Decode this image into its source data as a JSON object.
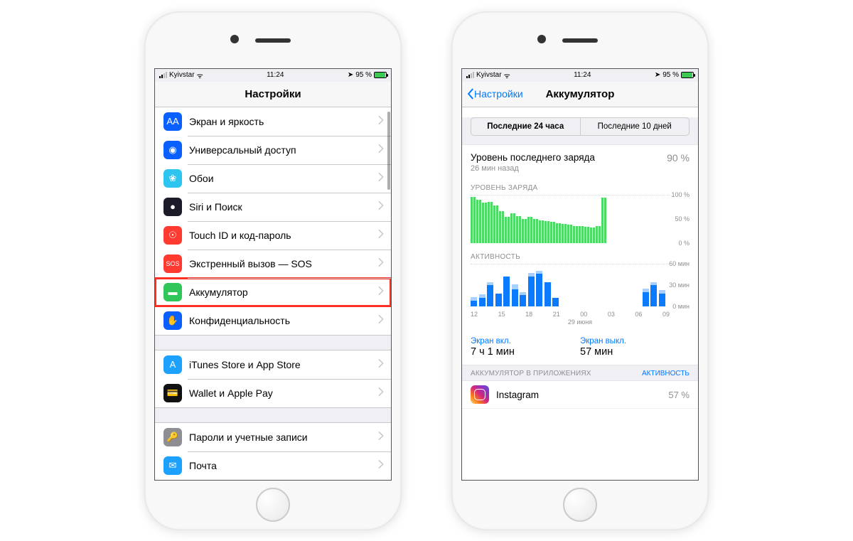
{
  "status": {
    "carrier": "Kyivstar",
    "time": "11:24",
    "battery_pct": "95 %"
  },
  "left": {
    "title": "Настройки",
    "items": [
      {
        "label": "Экран и яркость",
        "icon_bg": "#0a60ff",
        "icon_text": "AA"
      },
      {
        "label": "Универсальный доступ",
        "icon_bg": "#0a60ff",
        "icon_text": "◉"
      },
      {
        "label": "Обои",
        "icon_bg": "#2ec4f0",
        "icon_text": "❀"
      },
      {
        "label": "Siri и Поиск",
        "icon_bg": "#1b1b2a",
        "icon_text": "●"
      },
      {
        "label": "Touch ID и код-пароль",
        "icon_bg": "#ff3a30",
        "icon_text": "☉"
      },
      {
        "label": "Экстренный вызов — SOS",
        "icon_bg": "#ff3a30",
        "icon_text": "SOS"
      },
      {
        "label": "Аккумулятор",
        "icon_bg": "#31c65a",
        "icon_text": "▬",
        "highlight": true
      },
      {
        "label": "Конфиденциальность",
        "icon_bg": "#0a60ff",
        "icon_text": "✋"
      }
    ],
    "group2": [
      {
        "label": "iTunes Store и App Store",
        "icon_bg": "#1da1ff",
        "icon_text": "A"
      },
      {
        "label": "Wallet и Apple Pay",
        "icon_bg": "#111",
        "icon_text": "💳"
      }
    ],
    "group3": [
      {
        "label": "Пароли и учетные записи",
        "icon_bg": "#8e8e93",
        "icon_text": "🔑"
      },
      {
        "label": "Почта",
        "icon_bg": "#1da1ff",
        "icon_text": "✉"
      }
    ]
  },
  "right": {
    "back": "Настройки",
    "title": "Аккумулятор",
    "seg": {
      "a": "Последние 24 часа",
      "b": "Последние 10 дней"
    },
    "last_charge": {
      "title": "Уровень последнего заряда",
      "sub": "26 мин назад",
      "value": "90 %"
    },
    "charge_head": "УРОВЕНЬ ЗАРЯДА",
    "activity_head": "АКТИВНОСТЬ",
    "ylabs_charge": {
      "top": "100 %",
      "mid": "50 %",
      "bot": "0 %"
    },
    "ylabs_act": {
      "top": "60 мин",
      "mid": "30 мин",
      "bot": "0 мин"
    },
    "xlabels": [
      "12",
      "15",
      "18",
      "21",
      "00",
      "03",
      "06",
      "09"
    ],
    "xlabel_date": "29 июня",
    "usage": {
      "on_label": "Экран вкл.",
      "on_value": "7 ч 1 мин",
      "off_label": "Экран выкл.",
      "off_value": "57 мин"
    },
    "apps_head": "АККУМУЛЯТОР В ПРИЛОЖЕНИЯХ",
    "apps_action": "АКТИВНОСТЬ",
    "app1": {
      "name": "Instagram",
      "pct": "57 %"
    }
  },
  "chart_data": [
    {
      "type": "bar",
      "title": "Уровень заряда",
      "ylabel": "%",
      "ylim": [
        0,
        100
      ],
      "x_hours": [
        12,
        13,
        14,
        15,
        16,
        17,
        18,
        19,
        20,
        21,
        22,
        23,
        0,
        1,
        2,
        3,
        4,
        5,
        6,
        7,
        8,
        9,
        10,
        11
      ],
      "values": [
        96,
        90,
        84,
        86,
        78,
        66,
        54,
        62,
        56,
        50,
        55,
        50,
        48,
        46,
        44,
        42,
        40,
        38,
        36,
        36,
        34,
        32,
        36,
        94
      ]
    },
    {
      "type": "bar",
      "title": "Активность",
      "ylabel": "мин",
      "ylim": [
        0,
        60
      ],
      "x_hours": [
        12,
        13,
        14,
        15,
        16,
        17,
        18,
        19,
        20,
        21,
        22,
        23,
        0,
        1,
        2,
        3,
        4,
        5,
        6,
        7,
        8,
        9,
        10,
        11
      ],
      "series": [
        {
          "name": "Экран вкл.",
          "values": [
            8,
            12,
            30,
            18,
            42,
            24,
            16,
            42,
            46,
            34,
            12,
            0,
            0,
            0,
            0,
            0,
            0,
            0,
            0,
            0,
            0,
            20,
            30,
            18
          ]
        },
        {
          "name": "Экран выкл.",
          "values": [
            6,
            6,
            4,
            0,
            0,
            8,
            4,
            6,
            4,
            0,
            0,
            0,
            0,
            0,
            0,
            0,
            0,
            0,
            0,
            0,
            0,
            6,
            4,
            6
          ]
        }
      ]
    }
  ]
}
